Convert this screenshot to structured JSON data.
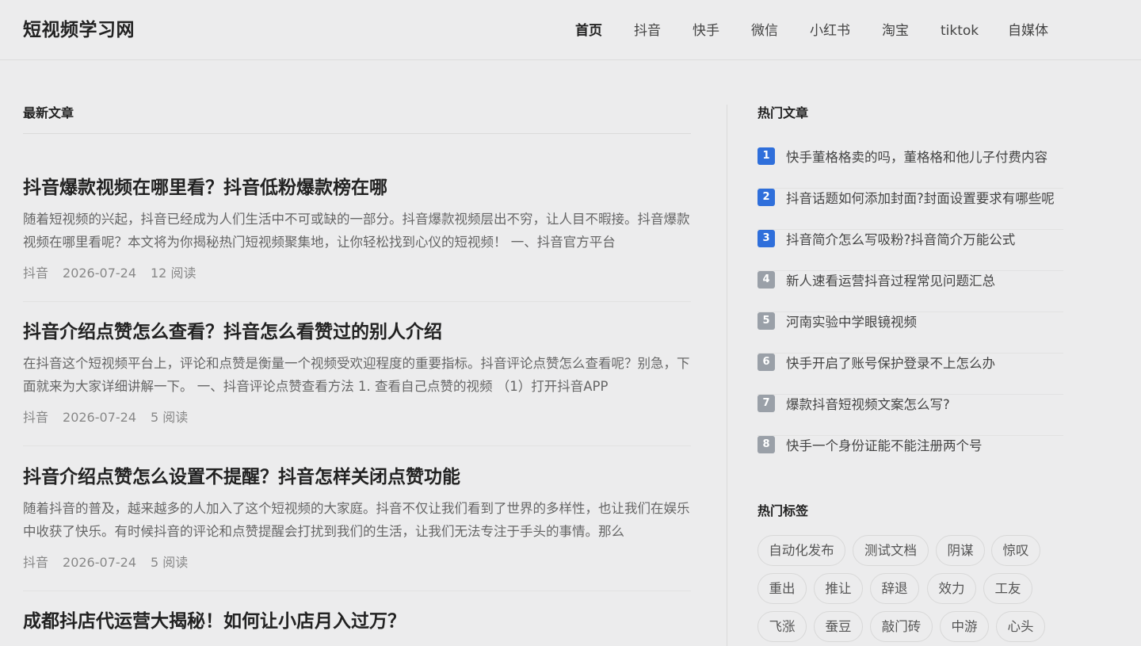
{
  "header": {
    "brand": "短视频学习网",
    "nav": [
      {
        "label": "首页",
        "active": true
      },
      {
        "label": "抖音",
        "active": false
      },
      {
        "label": "快手",
        "active": false
      },
      {
        "label": "微信",
        "active": false
      },
      {
        "label": "小红书",
        "active": false
      },
      {
        "label": "淘宝",
        "active": false
      },
      {
        "label": "tiktok",
        "active": false
      },
      {
        "label": "自媒体",
        "active": false
      }
    ]
  },
  "main": {
    "section_title": "最新文章",
    "articles": [
      {
        "title": "抖音爆款视频在哪里看？抖音低粉爆款榜在哪",
        "excerpt": "随着短视频的兴起，抖音已经成为人们生活中不可或缺的一部分。抖音爆款视频层出不穷，让人目不暇接。抖音爆款视频在哪里看呢？本文将为你揭秘热门短视频聚集地，让你轻松找到心仪的短视频！ 一、抖音官方平台",
        "category": "抖音",
        "date": "2026-07-24",
        "reads": "12 阅读"
      },
      {
        "title": "抖音介绍点赞怎么查看？抖音怎么看赞过的别人介绍",
        "excerpt": "在抖音这个短视频平台上，评论和点赞是衡量一个视频受欢迎程度的重要指标。抖音评论点赞怎么查看呢？别急，下面就来为大家详细讲解一下。 一、抖音评论点赞查看方法 1. 查看自己点赞的视频 （1）打开抖音APP",
        "category": "抖音",
        "date": "2026-07-24",
        "reads": "5 阅读"
      },
      {
        "title": "抖音介绍点赞怎么设置不提醒？抖音怎样关闭点赞功能",
        "excerpt": "随着抖音的普及，越来越多的人加入了这个短视频的大家庭。抖音不仅让我们看到了世界的多样性，也让我们在娱乐中收获了快乐。有时候抖音的评论和点赞提醒会打扰到我们的生活，让我们无法专注于手头的事情。那么",
        "category": "抖音",
        "date": "2026-07-24",
        "reads": "5 阅读"
      },
      {
        "title": "成都抖店代运营大揭秘！如何让小店月入过万？",
        "excerpt": "",
        "category": "",
        "date": "",
        "reads": ""
      }
    ]
  },
  "sidebar": {
    "hot_title": "热门文章",
    "hot_articles": [
      {
        "rank": "1",
        "title": "快手董格格卖的吗，董格格和他儿子付费内容"
      },
      {
        "rank": "2",
        "title": "抖音话题如何添加封面?封面设置要求有哪些呢"
      },
      {
        "rank": "3",
        "title": "抖音简介怎么写吸粉?抖音简介万能公式"
      },
      {
        "rank": "4",
        "title": "新人速看运营抖音过程常见问题汇总"
      },
      {
        "rank": "5",
        "title": "河南实验中学眼镜视频"
      },
      {
        "rank": "6",
        "title": "快手开启了账号保护登录不上怎么办"
      },
      {
        "rank": "7",
        "title": "爆款抖音短视频文案怎么写?"
      },
      {
        "rank": "8",
        "title": "快手一个身份证能不能注册两个号"
      }
    ],
    "rank_colors": {
      "top": "#2f6fdb",
      "rest": "#9aa0a8"
    },
    "tags_title": "热门标签",
    "tags": [
      [
        "自动化发布",
        "测试文档",
        "阴谋",
        "惊叹"
      ],
      [
        "重出",
        "推让",
        "辞退",
        "效力",
        "工友"
      ],
      [
        "飞涨",
        "蚕豆",
        "敲门砖",
        "中游",
        "心头"
      ]
    ]
  }
}
